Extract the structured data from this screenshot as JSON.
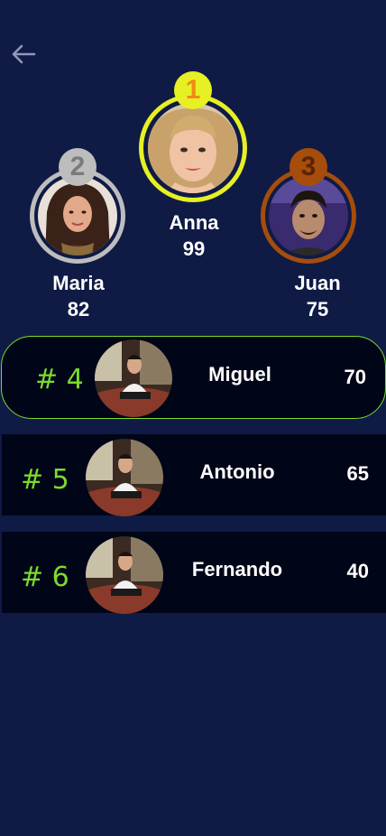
{
  "back_icon": "arrow-left-icon",
  "colors": {
    "background": "#0f1b45",
    "row_background": "#000518",
    "accent_green": "#7bdc2a",
    "gold": "#e6f023",
    "silver": "#bdbdbd",
    "bronze": "#a64d0c"
  },
  "podium": {
    "first": {
      "rank": "1",
      "name": "Anna",
      "score": "99"
    },
    "second": {
      "rank": "2",
      "name": "Maria",
      "score": "82"
    },
    "third": {
      "rank": "3",
      "name": "Juan",
      "score": "75"
    }
  },
  "rows": [
    {
      "rank": "# 4",
      "name": "Miguel",
      "score": "70"
    },
    {
      "rank": "# 5",
      "name": "Antonio",
      "score": "65"
    },
    {
      "rank": "# 6",
      "name": "Fernando",
      "score": "40"
    }
  ]
}
